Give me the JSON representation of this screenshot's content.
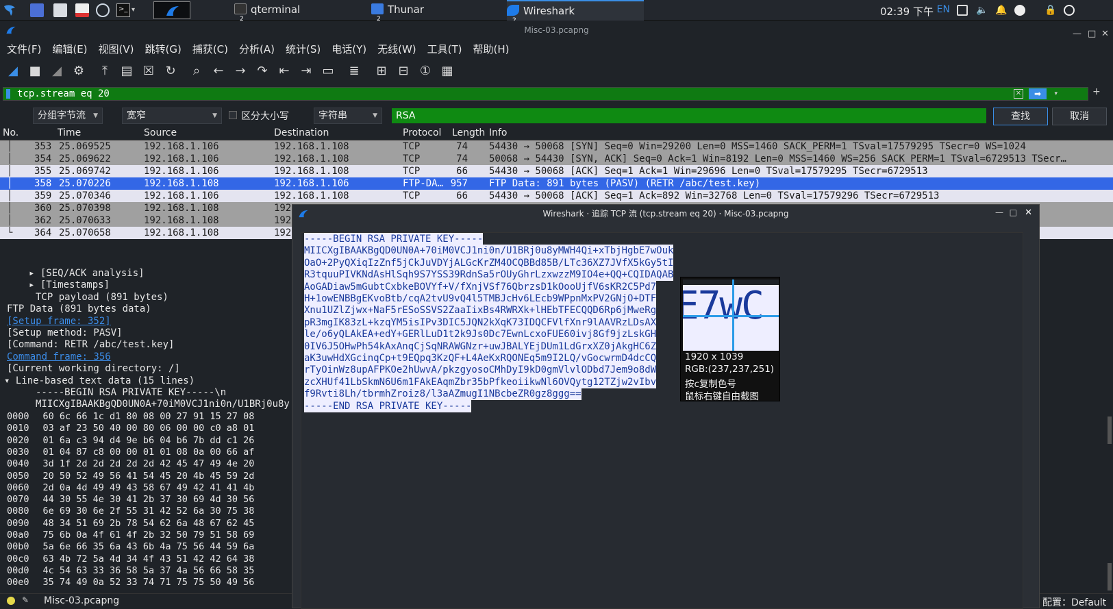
{
  "taskbar": {
    "tasks": [
      {
        "label": "qterminal",
        "badge": "2"
      },
      {
        "label": "Thunar",
        "badge": "2"
      },
      {
        "label": "Wireshark",
        "badge": "2"
      }
    ],
    "clock": "02:39 下午",
    "lang": "EN"
  },
  "window": {
    "title": "Misc-03.pcapng"
  },
  "menu": [
    "文件(F)",
    "编辑(E)",
    "视图(V)",
    "跳转(G)",
    "捕获(C)",
    "分析(A)",
    "统计(S)",
    "电话(Y)",
    "无线(W)",
    "工具(T)",
    "帮助(H)"
  ],
  "filter": {
    "value": "tcp.stream eq 20",
    "plus": "+"
  },
  "find": {
    "scope": "分组字节流",
    "width": "宽窄",
    "case_label": "区分大小写",
    "type": "字符串",
    "text": "RSA",
    "find_button": "查找",
    "cancel_button": "取消"
  },
  "columns": [
    "No.",
    "Time",
    "Source",
    "Destination",
    "Protocol",
    "Length",
    "Info"
  ],
  "packets": [
    {
      "no": "353",
      "time": "25.069525",
      "src": "192.168.1.106",
      "dst": "192.168.1.108",
      "proto": "TCP",
      "len": "74",
      "info": "54430 → 50068 [SYN] Seq=0 Win=29200 Len=0 MSS=1460 SACK_PERM=1 TSval=17579295 TSecr=0 WS=1024",
      "style": "gray"
    },
    {
      "no": "354",
      "time": "25.069622",
      "src": "192.168.1.106",
      "dst": "192.168.1.108",
      "proto": "TCP",
      "len": "74",
      "info": "50068 → 54430 [SYN, ACK] Seq=0 Ack=1 Win=8192 Len=0 MSS=1460 WS=256 SACK_PERM=1 TSval=6729513 TSecr…",
      "style": "gray"
    },
    {
      "no": "355",
      "time": "25.069742",
      "src": "192.168.1.106",
      "dst": "192.168.1.108",
      "proto": "TCP",
      "len": "66",
      "info": "54430 → 50068 [ACK] Seq=1 Ack=1 Win=29696 Len=0 TSval=17579295 TSecr=6729513",
      "style": "light"
    },
    {
      "no": "358",
      "time": "25.070226",
      "src": "192.168.1.108",
      "dst": "192.168.1.106",
      "proto": "FTP-DA…",
      "len": "957",
      "info": "FTP Data: 891 bytes (PASV) (RETR /abc/test.key)",
      "style": "sel"
    },
    {
      "no": "359",
      "time": "25.070346",
      "src": "192.168.1.106",
      "dst": "192.168.1.108",
      "proto": "TCP",
      "len": "66",
      "info": "54430 → 50068 [ACK] Seq=1 Ack=892 Win=32768 Len=0 TSval=17579296 TSecr=6729513",
      "style": "light"
    },
    {
      "no": "360",
      "time": "25.070398",
      "src": "192.168.1.108",
      "dst": "192",
      "proto": "",
      "len": "",
      "info": "",
      "style": "gray"
    },
    {
      "no": "362",
      "time": "25.070633",
      "src": "192.168.1.108",
      "dst": "192",
      "proto": "",
      "len": "",
      "info": "",
      "style": "gray"
    },
    {
      "no": "364",
      "time": "25.070658",
      "src": "192.168.1.108",
      "dst": "192",
      "proto": "",
      "len": "",
      "info": "",
      "style": "light"
    }
  ],
  "details": [
    {
      "text": "▸ [SEQ/ACK analysis]",
      "indent": 1,
      "link": false
    },
    {
      "text": "▸ [Timestamps]",
      "indent": 1,
      "link": false
    },
    {
      "text": "TCP payload (891 bytes)",
      "indent": 2,
      "link": false
    },
    {
      "text": "FTP Data (891 bytes data)",
      "indent": 0,
      "link": false
    },
    {
      "text": "[Setup frame: 352]",
      "indent": 0,
      "link": true
    },
    {
      "text": "[Setup method: PASV]",
      "indent": 0,
      "link": false
    },
    {
      "text": "[Command: RETR /abc/test.key]",
      "indent": 0,
      "link": false
    },
    {
      "text": "Command frame: 356",
      "indent": 0,
      "link": true
    },
    {
      "text": "[Current working directory: /]",
      "indent": 0,
      "link": false
    },
    {
      "text": "▾ Line-based text data (15 lines)",
      "indent": -1,
      "link": false
    },
    {
      "text": "-----BEGIN RSA PRIVATE KEY-----\\n",
      "indent": 2,
      "link": false
    },
    {
      "text": "MIICXgIBAAKBgQD0UN0A+70iM0VCJ1ni0n/U1BRj0u8y",
      "indent": 2,
      "link": false
    }
  ],
  "hex": [
    {
      "off": "0000",
      "bytes": "60 6c 66 1c d1 80 08 00  27 91 15 27 08"
    },
    {
      "off": "0010",
      "bytes": "03 af 23 50 40 00 80 06  00 00 c0 a8 01"
    },
    {
      "off": "0020",
      "bytes": "01 6a c3 94 d4 9e b6 04  b6 7b dd c1 26"
    },
    {
      "off": "0030",
      "bytes": "01 04 87 c8 00 00 01 01  08 0a 00 66 af"
    },
    {
      "off": "0040",
      "bytes": "3d 1f 2d 2d 2d 2d 2d 42  45 47 49 4e 20"
    },
    {
      "off": "0050",
      "bytes": "20 50 52 49 56 41 54 45  20 4b 45 59 2d"
    },
    {
      "off": "0060",
      "bytes": "2d 0a 4d 49 49 43 58 67  49 42 41 41 4b"
    },
    {
      "off": "0070",
      "bytes": "44 30 55 4e 30 41 2b 37  30 69 4d 30 56"
    },
    {
      "off": "0080",
      "bytes": "6e 69 30 6e 2f 55 31 42  52 6a 30 75 38"
    },
    {
      "off": "0090",
      "bytes": "48 34 51 69 2b 78 54 62  6a 48 67 62 45"
    },
    {
      "off": "00a0",
      "bytes": "75 6b 0a 4f 61 4f 2b 32  50 79 51 58 69"
    },
    {
      "off": "00b0",
      "bytes": "5a 6e 66 35 6a 43 6b 4a  75 56 44 59 6a"
    },
    {
      "off": "00c0",
      "bytes": "63 4b 72 5a 4d 34 4f 43  51 42 42 64 38"
    },
    {
      "off": "00d0",
      "bytes": "4c 54 63 33 36 58 5a 37  4a 56 66 58 35"
    },
    {
      "off": "00e0",
      "bytes": "35 74 49 0a 52 33 74 71  75 75 50 49 56"
    }
  ],
  "status": {
    "file": "Misc-03.pcapng",
    "profile": "配置：Default"
  },
  "dialog": {
    "title": "Wireshark · 追踪 TCP 流 (tcp.stream eq 20) · Misc-03.pcapng",
    "lines": [
      "-----BEGIN RSA PRIVATE KEY-----",
      "MIICXgIBAAKBgQD0UN0A+70iM0VCJ1ni0n/U1BRj0u8yMWH4Qi+xTbjHgbE7wOuk",
      "OaO+2PyQXiqIzZnf5jCkJuVDYjALGcKrZM4OCQBBd85B/LTc36XZ7JVfX5kGy5tI",
      "R3tquuPIVKNdAsHlSqh9S7YSS39RdnSa5rOUyGhrLzxwzzM9IO4e+QQ+CQIDAQAB",
      "AoGADiaw5mGubtCxbkeBOVYf+V/fXnjVSf76QbrzsD1kOooUjfV6sKR2C5Pd7",
      "H+1owENBBgEKvoBtb/cqA2tvU9vQ4l5TMBJcHv6LEcb9WPpnMxPV2GNjO+DTF",
      "Xnu1UZlZjwx+NaF5rESoSSVS2ZaaIixBs4RWRXk+lHEbTFECQQD6Rp6jMweRg",
      "pR3mgIK83zL+kzqYM5isIPv3DIC5JQN2kXqK73IDQCFVlfXnr9lAAVRzLDsAX",
      "le/o6yQLAkEA+edY+GERlLuD1t2k9Js0Dc7EwnLcxoFUE60ivj8Gf9jzLskGH",
      "0IV6J5OHwPh54kAxAnqCjSqNRAWGNzr+uwJBALYEjDUm1LdGrxXZ0jAkgHC6Z",
      "aK3uwHdXGcinqCp+t9EQpq3KzQF+L4AeKxRQONEq5m9I2LQ/vGocwrmD4dcCQ",
      "rTyOinWz8upAFPKOe2hUwvA/pkzgyosoCMhDyI9kD0gmVlvlODbd7Jem9o8dW",
      "zcXHUf41LbSkmN6U6m1FAkEAqmZbr35bPfkeoiikwNl6OVQytg12TZjw2vIbv",
      "f9Rvti8Lh/tbrmhZroiz8/l3aAZmugI1NBcbeZR0gz8ggg==",
      "-----END RSA PRIVATE KEY-----"
    ]
  },
  "magnifier": {
    "zoom_text": "E7wC",
    "size": "1920 x 1039",
    "rgb": "RGB:(237,237,251)",
    "hint1": "按c复制色号",
    "hint2": "鼠标右键自由截图"
  },
  "colors": {
    "filter_bg": "#0f7a12",
    "selected_row": "#3367e6",
    "stream_text": "#1a3a9c"
  }
}
